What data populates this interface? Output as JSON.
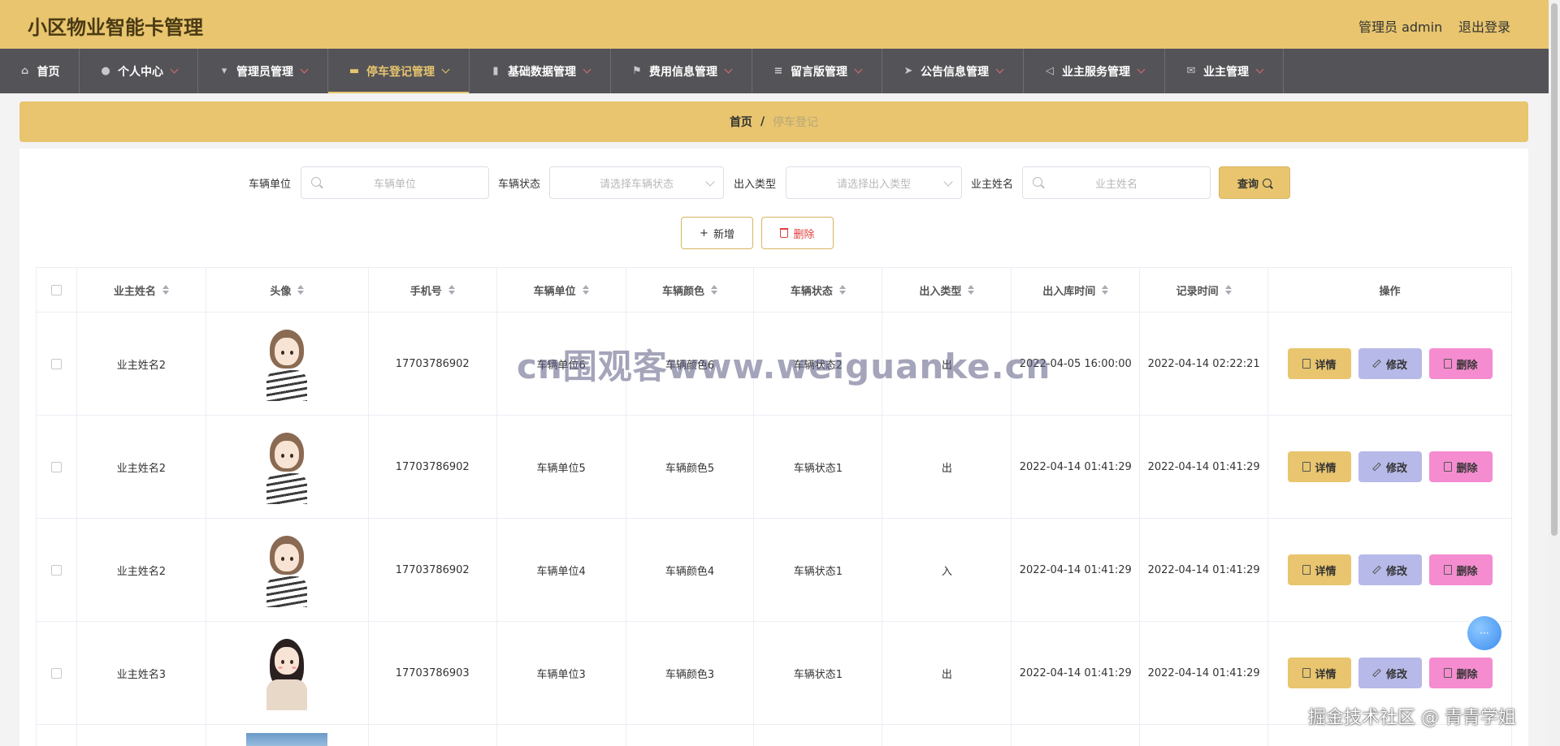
{
  "header": {
    "title": "小区物业智能卡管理",
    "admin": "管理员 admin",
    "logout": "退出登录"
  },
  "nav": [
    {
      "label": "首页",
      "icon": "home-icon",
      "caret": false
    },
    {
      "label": "个人中心",
      "icon": "user-icon",
      "caret": true
    },
    {
      "label": "管理员管理",
      "icon": "pin-icon",
      "caret": true
    },
    {
      "label": "停车登记管理",
      "icon": "chat-icon",
      "caret": true,
      "active": true
    },
    {
      "label": "基础数据管理",
      "icon": "bar-chart-icon",
      "caret": true
    },
    {
      "label": "费用信息管理",
      "icon": "flag-icon",
      "caret": true
    },
    {
      "label": "留言版管理",
      "icon": "menu-icon",
      "caret": true
    },
    {
      "label": "公告信息管理",
      "icon": "send-icon",
      "caret": true
    },
    {
      "label": "业主服务管理",
      "icon": "navigation-icon",
      "caret": true
    },
    {
      "label": "业主管理",
      "icon": "mail-icon",
      "caret": true
    }
  ],
  "breadcrumb": {
    "home": "首页",
    "separator": "/",
    "current": "停车登记"
  },
  "search": {
    "unit_label": "车辆单位",
    "unit_placeholder": "车辆单位",
    "status_label": "车辆状态",
    "status_placeholder": "请选择车辆状态",
    "type_label": "出入类型",
    "type_placeholder": "请选择出入类型",
    "owner_label": "业主姓名",
    "owner_placeholder": "业主姓名",
    "query": "查询"
  },
  "actions": {
    "add": "新增",
    "delete": "删除"
  },
  "table": {
    "headers": [
      "业主姓名",
      "头像",
      "手机号",
      "车辆单位",
      "车辆颜色",
      "车辆状态",
      "出入类型",
      "出入库时间",
      "记录时间",
      "操作"
    ],
    "rows": [
      {
        "owner": "业主姓名2",
        "avatar": "girl-striped-shirt",
        "phone": "17703786902",
        "unit": "车辆单位6",
        "color": "车辆颜色6",
        "status": "车辆状态2",
        "type": "出",
        "in_out_time": "2022-04-05 16:00:00",
        "record_time": "2022-04-14 02:22:21"
      },
      {
        "owner": "业主姓名2",
        "avatar": "girl-striped-shirt",
        "phone": "17703786902",
        "unit": "车辆单位5",
        "color": "车辆颜色5",
        "status": "车辆状态1",
        "type": "出",
        "in_out_time": "2022-04-14 01:41:29",
        "record_time": "2022-04-14 01:41:29"
      },
      {
        "owner": "业主姓名2",
        "avatar": "girl-striped-shirt",
        "phone": "17703786902",
        "unit": "车辆单位4",
        "color": "车辆颜色4",
        "status": "车辆状态1",
        "type": "入",
        "in_out_time": "2022-04-14 01:41:29",
        "record_time": "2022-04-14 01:41:29"
      },
      {
        "owner": "业主姓名3",
        "avatar": "girl-long-hair",
        "phone": "17703786903",
        "unit": "车辆单位3",
        "color": "车辆颜色3",
        "status": "车辆状态1",
        "type": "出",
        "in_out_time": "2022-04-14 01:41:29",
        "record_time": "2022-04-14 01:41:29"
      }
    ],
    "row_actions": {
      "detail": "详情",
      "edit": "修改",
      "delete": "删除"
    }
  },
  "overlays": {
    "watermark": "cn围观客www.weiguanke.cn",
    "corner_mark": "掘金技术社区 @ 青青学姐"
  },
  "colors": {
    "accent": "#e8c56e",
    "nav_bg": "#545458",
    "detail": "#e8c56e",
    "edit": "#b7b9e8",
    "delete": "#f58cd0"
  }
}
